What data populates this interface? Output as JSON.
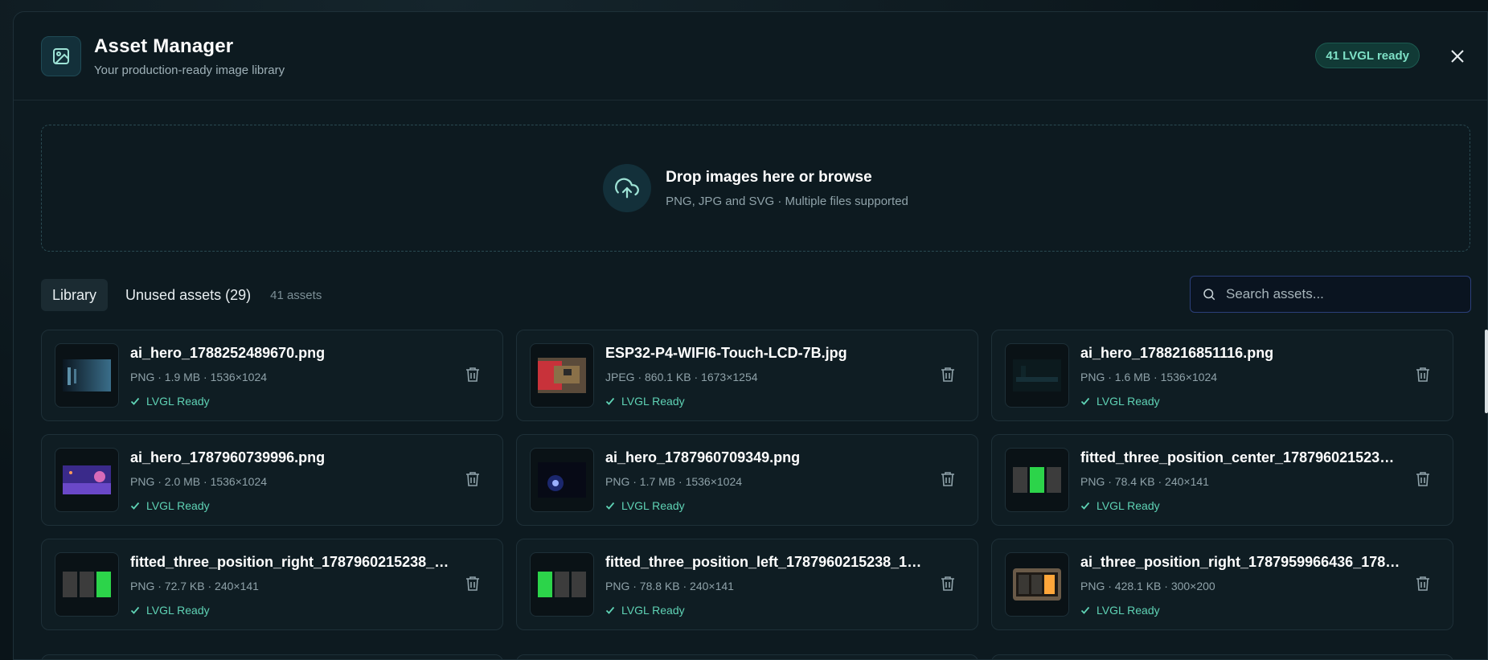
{
  "header": {
    "title": "Asset Manager",
    "subtitle": "Your production-ready image library",
    "badge": "41 LVGL ready"
  },
  "dropzone": {
    "title": "Drop images here or browse",
    "subtitle": "PNG, JPG and SVG · Multiple files supported"
  },
  "tabs": {
    "library": "Library",
    "unused": "Unused assets (29)",
    "count": "41 assets"
  },
  "search": {
    "placeholder": "Search assets..."
  },
  "assets": [
    {
      "name": "ai_hero_1788252489670.png",
      "meta": "PNG · 1.9 MB · 1536×1024",
      "status": "LVGL Ready",
      "thumb": "dark-room"
    },
    {
      "name": "ESP32-P4-WIFI6-Touch-LCD-7B.jpg",
      "meta": "JPEG · 860.1 KB · 1673×1254",
      "status": "LVGL Ready",
      "thumb": "circuit-board"
    },
    {
      "name": "ai_hero_1788216851116.png",
      "meta": "PNG · 1.6 MB · 1536×1024",
      "status": "LVGL Ready",
      "thumb": "dark-scene"
    },
    {
      "name": "ai_hero_1787960739996.png",
      "meta": "PNG · 2.0 MB · 1536×1024",
      "status": "LVGL Ready",
      "thumb": "space-scene"
    },
    {
      "name": "ai_hero_1787960709349.png",
      "meta": "PNG · 1.7 MB · 1536×1024",
      "status": "LVGL Ready",
      "thumb": "blue-glow"
    },
    {
      "name": "fitted_three_position_center_1787960215238_...",
      "meta": "PNG · 78.4 KB · 240×141",
      "status": "LVGL Ready",
      "thumb": "switch-center"
    },
    {
      "name": "fitted_three_position_right_1787960215238_1...",
      "meta": "PNG · 72.7 KB · 240×141",
      "status": "LVGL Ready",
      "thumb": "switch-right"
    },
    {
      "name": "fitted_three_position_left_1787960215238_17...",
      "meta": "PNG · 78.8 KB · 240×141",
      "status": "LVGL Ready",
      "thumb": "switch-left"
    },
    {
      "name": "ai_three_position_right_1787959966436_1787...",
      "meta": "PNG · 428.1 KB · 300×200",
      "status": "LVGL Ready",
      "thumb": "switch-amber"
    }
  ],
  "colors": {
    "accent": "#5fd3b5",
    "badge_bg": "#113a36",
    "background": "#0d1a20"
  }
}
